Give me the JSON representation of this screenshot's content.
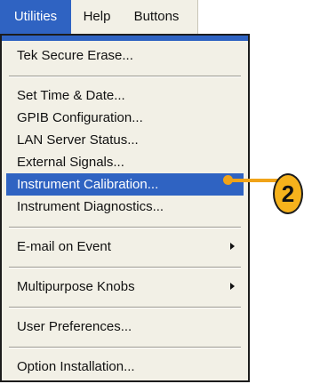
{
  "menubar": {
    "items": [
      {
        "label": "Utilities"
      },
      {
        "label": "Help"
      },
      {
        "label": "Buttons"
      }
    ]
  },
  "menu": {
    "items": [
      {
        "label": "Tek Secure Erase..."
      },
      {
        "label": "Set Time & Date..."
      },
      {
        "label": "GPIB Configuration..."
      },
      {
        "label": "LAN Server Status..."
      },
      {
        "label": "External Signals..."
      },
      {
        "label": "Instrument Calibration..."
      },
      {
        "label": "Instrument Diagnostics..."
      },
      {
        "label": "E-mail on Event"
      },
      {
        "label": "Multipurpose Knobs"
      },
      {
        "label": "User Preferences..."
      },
      {
        "label": "Option Installation..."
      }
    ]
  },
  "callout": {
    "number": "2"
  },
  "colors": {
    "highlight": "#2f63c2",
    "callout": "#f6b21c",
    "menu_bg": "#f2f0e6"
  }
}
